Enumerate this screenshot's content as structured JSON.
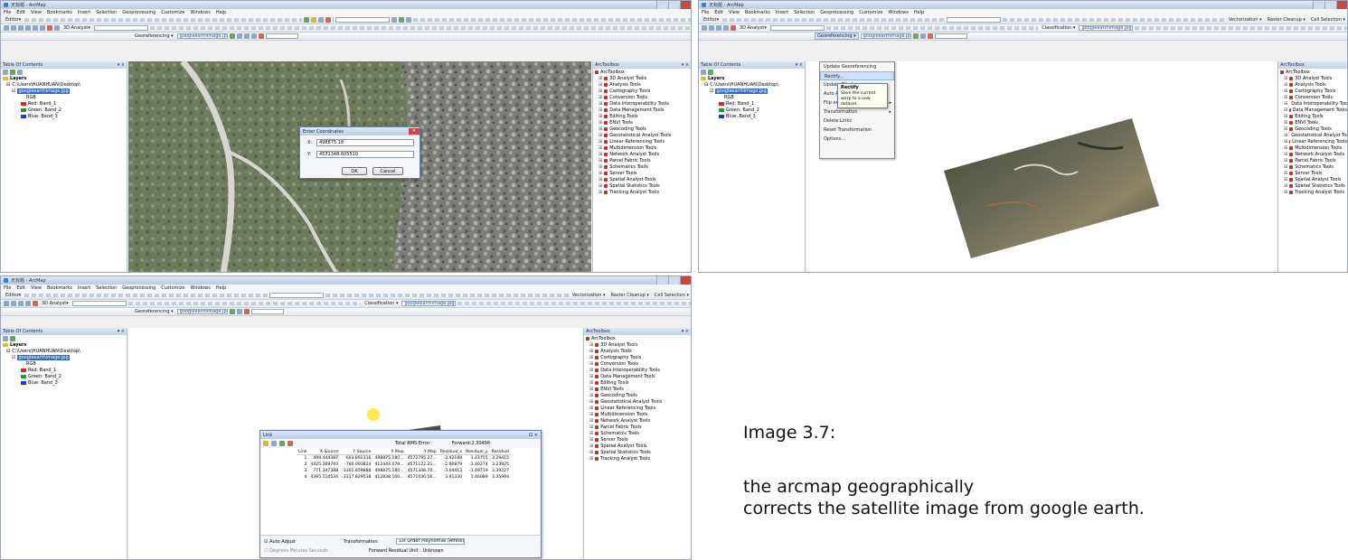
{
  "window": {
    "title": "无标题 - ArcMap",
    "menus": [
      "File",
      "Edit",
      "View",
      "Bookmarks",
      "Insert",
      "Selection",
      "Geoprocessing",
      "Customize",
      "Windows",
      "Help"
    ]
  },
  "toolbar": {
    "editor": "Editor▾",
    "analyst3d": "3D Analyst▾",
    "vectorization": "Vectorization ▾",
    "raster_cleanup": "Raster Cleanup ▾",
    "cell_selection": "Cell Selection ▾",
    "classification": "Classification ▾",
    "classification_layer": "googleearthimage.jpg",
    "georeferencing": "Georeferencing ▾",
    "georef_layer": "googleearthimage.jpg"
  },
  "toc": {
    "title": "Table Of Contents",
    "layers": "Layers",
    "folder": "C:\\Users\\HUANHUAN\\Desktop\\",
    "file": "googleearthimage.jpg",
    "rgb": "RGB",
    "bands": [
      {
        "label": "Red:  Band_1",
        "color": "#e0231f"
      },
      {
        "label": "Green: Band_2",
        "color": "#1f9e2a"
      },
      {
        "label": "Blue:  Band_3",
        "color": "#1f39d6"
      }
    ]
  },
  "arctoolbox": {
    "title": "ArcToolbox",
    "root": "ArcToolbox",
    "tools": [
      "3D Analyst Tools",
      "Analysis Tools",
      "Cartography Tools",
      "Conversion Tools",
      "Data Interoperability Tools",
      "Data Management Tools",
      "Editing Tools",
      "ENVI Tools",
      "Geocoding Tools",
      "Geostatistical Analyst Tools",
      "Linear Referencing Tools",
      "Multidimension Tools",
      "Network Analyst Tools",
      "Parcel Fabric Tools",
      "Schematics Tools",
      "Server Tools",
      "Spatial Analyst Tools",
      "Spatial Statistics Tools",
      "Tracking Analyst Tools"
    ]
  },
  "coord_dialog": {
    "title": "Enter Coordinates",
    "x_label": "X:",
    "x_value": "498875.18",
    "y_label": "Y:",
    "y_value": "4571348.605510",
    "ok": "OK",
    "cancel": "Cancel"
  },
  "georef_menu": {
    "items": [
      "Update Georeferencing",
      "Rectify...",
      "Update Display",
      "Auto Adjust",
      "Flip or Rotate",
      "Transformation",
      "Delete Links",
      "Reset Transformation",
      "Options..."
    ],
    "submenu_item": "Rectify",
    "tooltip": "Save the current warp to a new dataset."
  },
  "link_table": {
    "title": "Link",
    "total_error_label": "Total RMS Error:",
    "forward_label": "Forward:2.30456",
    "headers": [
      "Link",
      "X Source",
      "Y Source",
      "X Map",
      "Y Map",
      "Residual_x",
      "Residual_y",
      "Residual"
    ],
    "rows": [
      [
        "1",
        "499.444387",
        "-603.892316",
        "498875.180...",
        "4572795.27...",
        "-2.42189",
        "1.43755",
        "3.29415"
      ],
      [
        "2",
        "4425.369793",
        "-760.093824",
        "412444.079...",
        "4571122.21...",
        "-2.90879",
        "-1.40274",
        "3.23925"
      ],
      [
        "3",
        "771.347388",
        "-3301.859888",
        "498875.180...",
        "4571348.70...",
        "-3.04413",
        "-1.49719",
        "3.39227"
      ],
      [
        "4",
        "4395.114534",
        "-3317.829538",
        "412838.100...",
        "4571030.56...",
        "3.91330",
        "1.46089",
        "3.35994"
      ]
    ],
    "auto_adjust": "Auto Adjust",
    "transformation_label": "Transformation:",
    "transformation_value": "1st Order Polynomial (Affine)",
    "degrees_label": "Degrees Minutes Seconds",
    "forward_residual": "Forward Residual Unit : Unknown"
  },
  "caption": {
    "line1": "Image 3.7:",
    "line2": "the arcmap geographically",
    "line3": "corrects the satellite image from google earth."
  },
  "colors": {
    "accent": "#316ac5",
    "toolbox_icon": "#b5362b",
    "title_bar": "#b9cbe3"
  }
}
